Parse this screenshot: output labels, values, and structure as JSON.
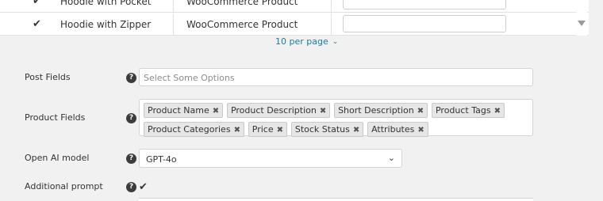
{
  "table": {
    "rows": [
      {
        "check": "✔",
        "name": "Hoodie with Pocket",
        "type": "WooCommerce Product"
      },
      {
        "check": "✔",
        "name": "Hoodie with Zipper",
        "type": "WooCommerce Product"
      }
    ]
  },
  "pagination": {
    "per_page_label": "10 per page",
    "chevron": "chevron-down-icon"
  },
  "form": {
    "post_fields": {
      "label": "Post Fields",
      "placeholder": "Select Some Options"
    },
    "product_fields": {
      "label": "Product Fields",
      "tags": [
        "Product Name",
        "Product Description",
        "Short Description",
        "Product Tags",
        "Product Categories",
        "Price",
        "Stock Status",
        "Attributes"
      ]
    },
    "open_ai_model": {
      "label": "Open AI model",
      "value": "GPT-4o"
    },
    "additional_prompt": {
      "label": "Additional prompt",
      "checked": "✔"
    }
  },
  "help_glyph": "?",
  "tag_remove_glyph": "✖",
  "colors": {
    "background": "#f1f1f1",
    "link": "#1f7a9f",
    "help_icon": "#3c3c3c"
  }
}
